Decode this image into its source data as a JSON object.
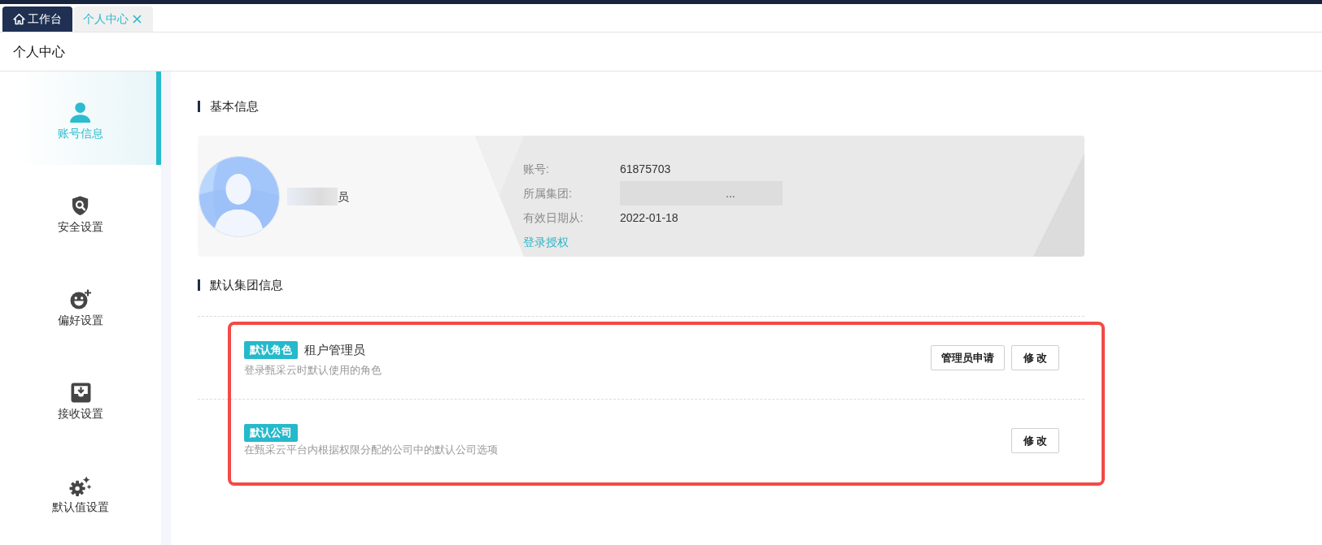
{
  "tabs": [
    {
      "kind": "home",
      "label": "工作台",
      "selected": false,
      "closable": false
    },
    {
      "kind": "page",
      "label": "个人中心",
      "selected": true,
      "closable": true
    }
  ],
  "page_header": {
    "title": "个人中心"
  },
  "sidebar": {
    "items": [
      {
        "label": "账号信息",
        "selected": true
      },
      {
        "label": "安全设置",
        "selected": false
      },
      {
        "label": "偏好设置",
        "selected": false
      },
      {
        "label": "接收设置",
        "selected": false
      },
      {
        "label": "默认值设置",
        "selected": false
      }
    ]
  },
  "basic_info": {
    "title": "基本信息",
    "profile": {
      "name": "员",
      "redacted": true
    },
    "fields": [
      {
        "label": "账号:",
        "value": "61875703",
        "redacted": false
      },
      {
        "label": "所属集团:",
        "value": "...",
        "redacted": true
      },
      {
        "label": "有效日期从:",
        "value": "2022-01-18",
        "redacted": false
      }
    ],
    "link": "登录授权"
  },
  "default_group": {
    "title": "默认集团信息",
    "highlighted": true,
    "entries": [
      {
        "tag": "默认角色",
        "value": "租户管理员",
        "description": "登录甄采云时默认使用的角色",
        "buttons": [
          "管理员申请",
          "修 改"
        ]
      },
      {
        "tag": "默认公司",
        "description": "在甄采云平台内根据权限分配的公司中的默认公司选项",
        "buttons": [
          "修 改"
        ]
      }
    ]
  }
}
